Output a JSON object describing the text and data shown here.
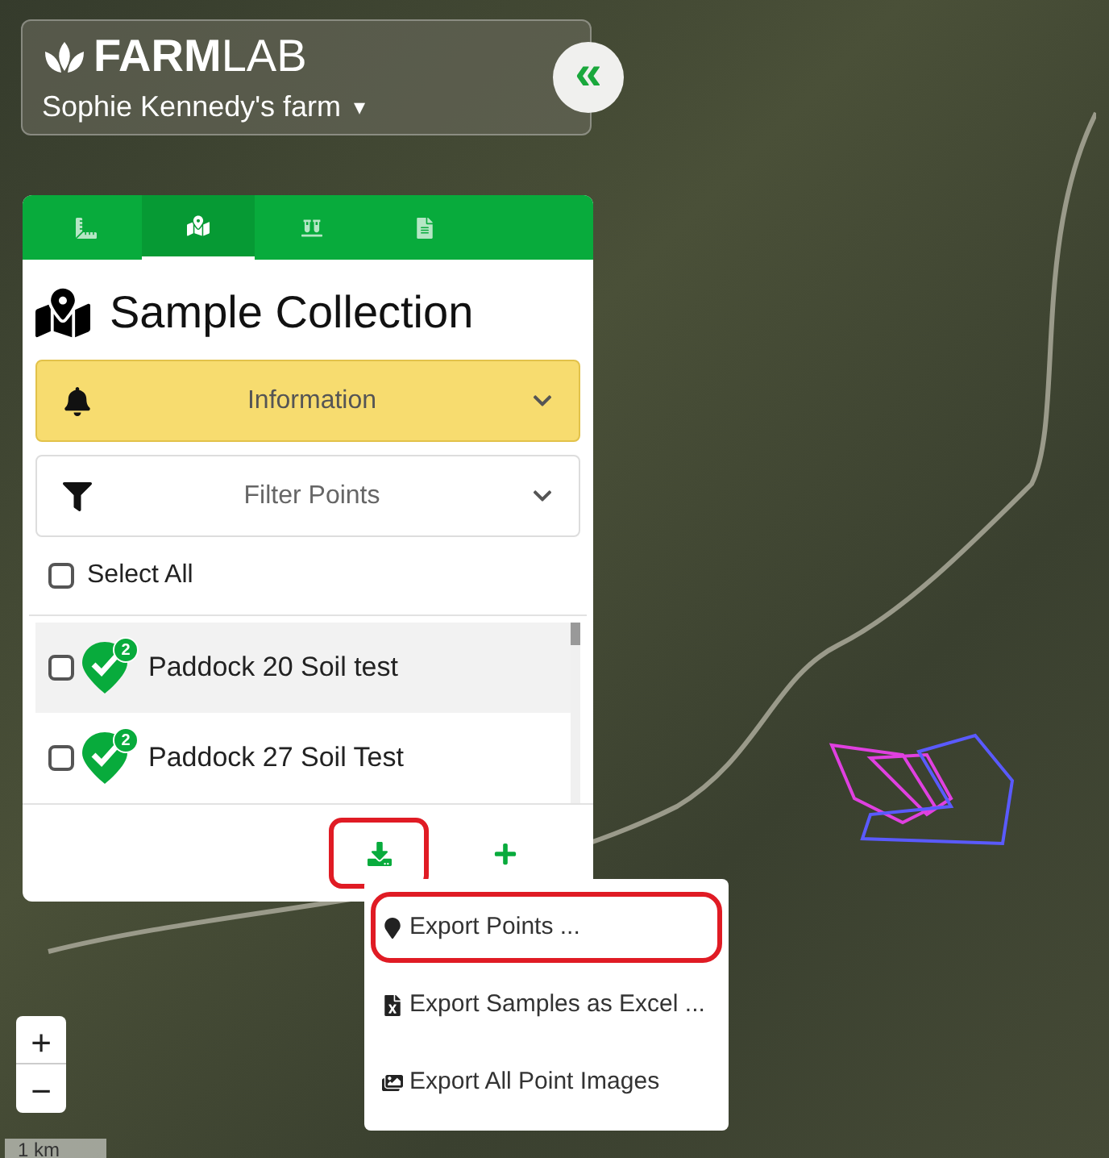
{
  "header": {
    "logo_bold": "FARM",
    "logo_light": "LAB",
    "farm": "Sophie Kennedy's farm",
    "caret": "▾",
    "collapse": "«"
  },
  "panel": {
    "tabs": [
      {
        "kind": "measure",
        "selected": false
      },
      {
        "kind": "map",
        "selected": true
      },
      {
        "kind": "samples",
        "selected": false
      },
      {
        "kind": "report",
        "selected": false
      }
    ],
    "title": "Sample Collection",
    "sections": [
      {
        "kind": "alert",
        "label": "Information",
        "expanded": false
      },
      {
        "kind": "filter",
        "label": "Filter Points",
        "expanded": false
      }
    ],
    "select_all": {
      "label": "Select All",
      "checked": false
    },
    "items": [
      {
        "label": "Paddock 20 Soil test",
        "badge": "2",
        "checked": false,
        "selected": true
      },
      {
        "label": "Paddock 27 Soil Test",
        "badge": "2",
        "checked": false,
        "selected": false
      }
    ],
    "actions": [
      {
        "kind": "download",
        "annotated": true
      },
      {
        "kind": "add",
        "annotated": false
      }
    ]
  },
  "export_menu": [
    {
      "kind": "pin",
      "label": "Export Points ...",
      "annotated": true
    },
    {
      "kind": "excel",
      "label": "Export Samples as Excel ...",
      "annotated": false
    },
    {
      "kind": "images",
      "label": "Export All Point Images",
      "annotated": false
    }
  ],
  "zoom": {
    "in": "+",
    "out": "−"
  },
  "scale": "1 km"
}
